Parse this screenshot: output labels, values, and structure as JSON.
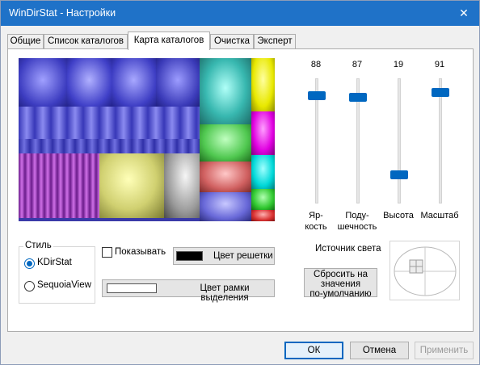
{
  "window": {
    "title": "WinDirStat - Настройки",
    "close_glyph": "✕"
  },
  "tabs": [
    {
      "label": "Общие"
    },
    {
      "label": "Список каталогов"
    },
    {
      "label": "Карта каталогов"
    },
    {
      "label": "Очистка"
    },
    {
      "label": "Эксперт"
    }
  ],
  "sliders": [
    {
      "value": "88",
      "label_line1": "Яр-",
      "label_line2": "кость",
      "level_pct": 88
    },
    {
      "value": "87",
      "label_line1": "Поду-",
      "label_line2": "шечность",
      "level_pct": 87
    },
    {
      "value": "19",
      "label_line1": "Высота",
      "label_line2": "",
      "level_pct": 19
    },
    {
      "value": "91",
      "label_line1": "Масштаб",
      "label_line2": "",
      "level_pct": 91
    }
  ],
  "style_group": {
    "title": "Стиль",
    "options": [
      {
        "label": "KDirStat",
        "selected": true
      },
      {
        "label": "SequoiaView",
        "selected": false
      }
    ]
  },
  "grid": {
    "show_label": "Показывать",
    "show_checked": false,
    "color_button_label": "Цвет решетки",
    "color": "#000000"
  },
  "selection_frame": {
    "color_button_label": "Цвет рамки выделения",
    "color": "#ffffff"
  },
  "light_source": {
    "label": "Источник света"
  },
  "reset_button": {
    "line1": "Сбросить на",
    "line2": "значения",
    "line3": "по-умолчанию"
  },
  "footer": {
    "ok": "ОК",
    "cancel": "Отмена",
    "apply": "Применить"
  },
  "colors": {
    "accent": "#0067c0",
    "titlebar": "#1f72c8"
  }
}
